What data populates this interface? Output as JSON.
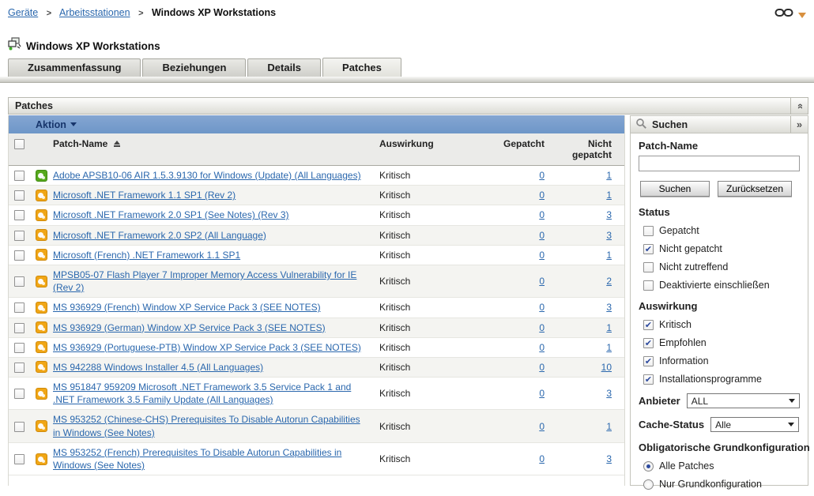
{
  "breadcrumb": {
    "separator": ">",
    "items": [
      "Geräte",
      "Arbeitsstationen",
      "Windows XP Workstations"
    ]
  },
  "header": {
    "title": "Windows XP Workstations"
  },
  "tabs": [
    {
      "label": "Zusammenfassung",
      "active": false
    },
    {
      "label": "Beziehungen",
      "active": false
    },
    {
      "label": "Details",
      "active": false
    },
    {
      "label": "Patches",
      "active": true
    }
  ],
  "panel": {
    "title": "Patches"
  },
  "table": {
    "action_label": "Aktion",
    "columns": {
      "name": "Patch-Name",
      "impact": "Auswirkung",
      "patched": "Gepatcht",
      "not_patched": "Nicht gepatcht"
    },
    "rows": [
      {
        "icon": "green-patch-icon",
        "name": "Adobe APSB10-06 AIR 1.5.3.9130 for Windows (Update) (All Languages)",
        "impact": "Kritisch",
        "patched": "0",
        "not_patched": "1"
      },
      {
        "icon": "yellow-patch-icon",
        "name": "Microsoft .NET Framework 1.1 SP1 (Rev 2)",
        "impact": "Kritisch",
        "patched": "0",
        "not_patched": "1"
      },
      {
        "icon": "yellow-patch-icon",
        "name": "Microsoft .NET Framework 2.0 SP1 (See Notes) (Rev 3)",
        "impact": "Kritisch",
        "patched": "0",
        "not_patched": "3"
      },
      {
        "icon": "yellow-patch-icon",
        "name": "Microsoft .NET Framework 2.0 SP2 (All Language)",
        "impact": "Kritisch",
        "patched": "0",
        "not_patched": "3"
      },
      {
        "icon": "yellow-patch-icon",
        "name": "Microsoft (French) .NET Framework 1.1 SP1",
        "impact": "Kritisch",
        "patched": "0",
        "not_patched": "1"
      },
      {
        "icon": "yellow-patch-icon",
        "name": "MPSB05-07 Flash Player 7 Improper Memory Access Vulnerability for IE (Rev 2)",
        "impact": "Kritisch",
        "patched": "0",
        "not_patched": "2"
      },
      {
        "icon": "yellow-patch-icon",
        "name": "MS 936929 (French) Window XP Service Pack 3 (SEE NOTES)",
        "impact": "Kritisch",
        "patched": "0",
        "not_patched": "3"
      },
      {
        "icon": "yellow-patch-icon",
        "name": "MS 936929 (German) Window XP Service Pack 3 (SEE NOTES)",
        "impact": "Kritisch",
        "patched": "0",
        "not_patched": "1"
      },
      {
        "icon": "yellow-patch-icon",
        "name": "MS 936929 (Portuguese-PTB) Window XP Service Pack 3 (SEE NOTES)",
        "impact": "Kritisch",
        "patched": "0",
        "not_patched": "1"
      },
      {
        "icon": "yellow-patch-icon",
        "name": "MS 942288 Windows Installer 4.5 (All Languages)",
        "impact": "Kritisch",
        "patched": "0",
        "not_patched": "10"
      },
      {
        "icon": "yellow-patch-icon",
        "name": "MS 951847 959209 Microsoft .NET Framework 3.5 Service Pack 1 and .NET Framework 3.5 Family Update (All Languages)",
        "impact": "Kritisch",
        "patched": "0",
        "not_patched": "3"
      },
      {
        "icon": "yellow-patch-icon",
        "name": "MS 953252 (Chinese-CHS) Prerequisites To Disable Autorun Capabilities in Windows (See Notes)",
        "impact": "Kritisch",
        "patched": "0",
        "not_patched": "1"
      },
      {
        "icon": "yellow-patch-icon",
        "name": "MS 953252 (French) Prerequisites To Disable Autorun Capabilities in Windows (See Notes)",
        "impact": "Kritisch",
        "patched": "0",
        "not_patched": "3"
      }
    ]
  },
  "search_panel": {
    "title": "Suchen",
    "patch_name_label": "Patch-Name",
    "patch_name_value": "",
    "search_button": "Suchen",
    "reset_button": "Zurücksetzen",
    "status": {
      "heading": "Status",
      "options": [
        {
          "label": "Gepatcht",
          "checked": false
        },
        {
          "label": "Nicht gepatcht",
          "checked": true
        },
        {
          "label": "Nicht zutreffend",
          "checked": false
        },
        {
          "label": "Deaktivierte einschließen",
          "checked": false
        }
      ]
    },
    "impact": {
      "heading": "Auswirkung",
      "options": [
        {
          "label": "Kritisch",
          "checked": true
        },
        {
          "label": "Empfohlen",
          "checked": true
        },
        {
          "label": "Information",
          "checked": true
        },
        {
          "label": "Installationsprogramme",
          "checked": true
        }
      ]
    },
    "vendor": {
      "label": "Anbieter",
      "value": "ALL"
    },
    "cache_status": {
      "label": "Cache-Status",
      "value": "Alle"
    },
    "baseline": {
      "heading": "Obligatorische Grundkonfiguration",
      "options": [
        {
          "label": "Alle Patches",
          "selected": true
        },
        {
          "label": "Nur Grundkonfiguration",
          "selected": false
        }
      ]
    }
  },
  "colors": {
    "action_bar_bg": "#6e96c8",
    "link_color": "#2a67ad",
    "patch_green": "#56a81c",
    "patch_yellow": "#f0a616",
    "check_color": "#2d4a9e"
  }
}
